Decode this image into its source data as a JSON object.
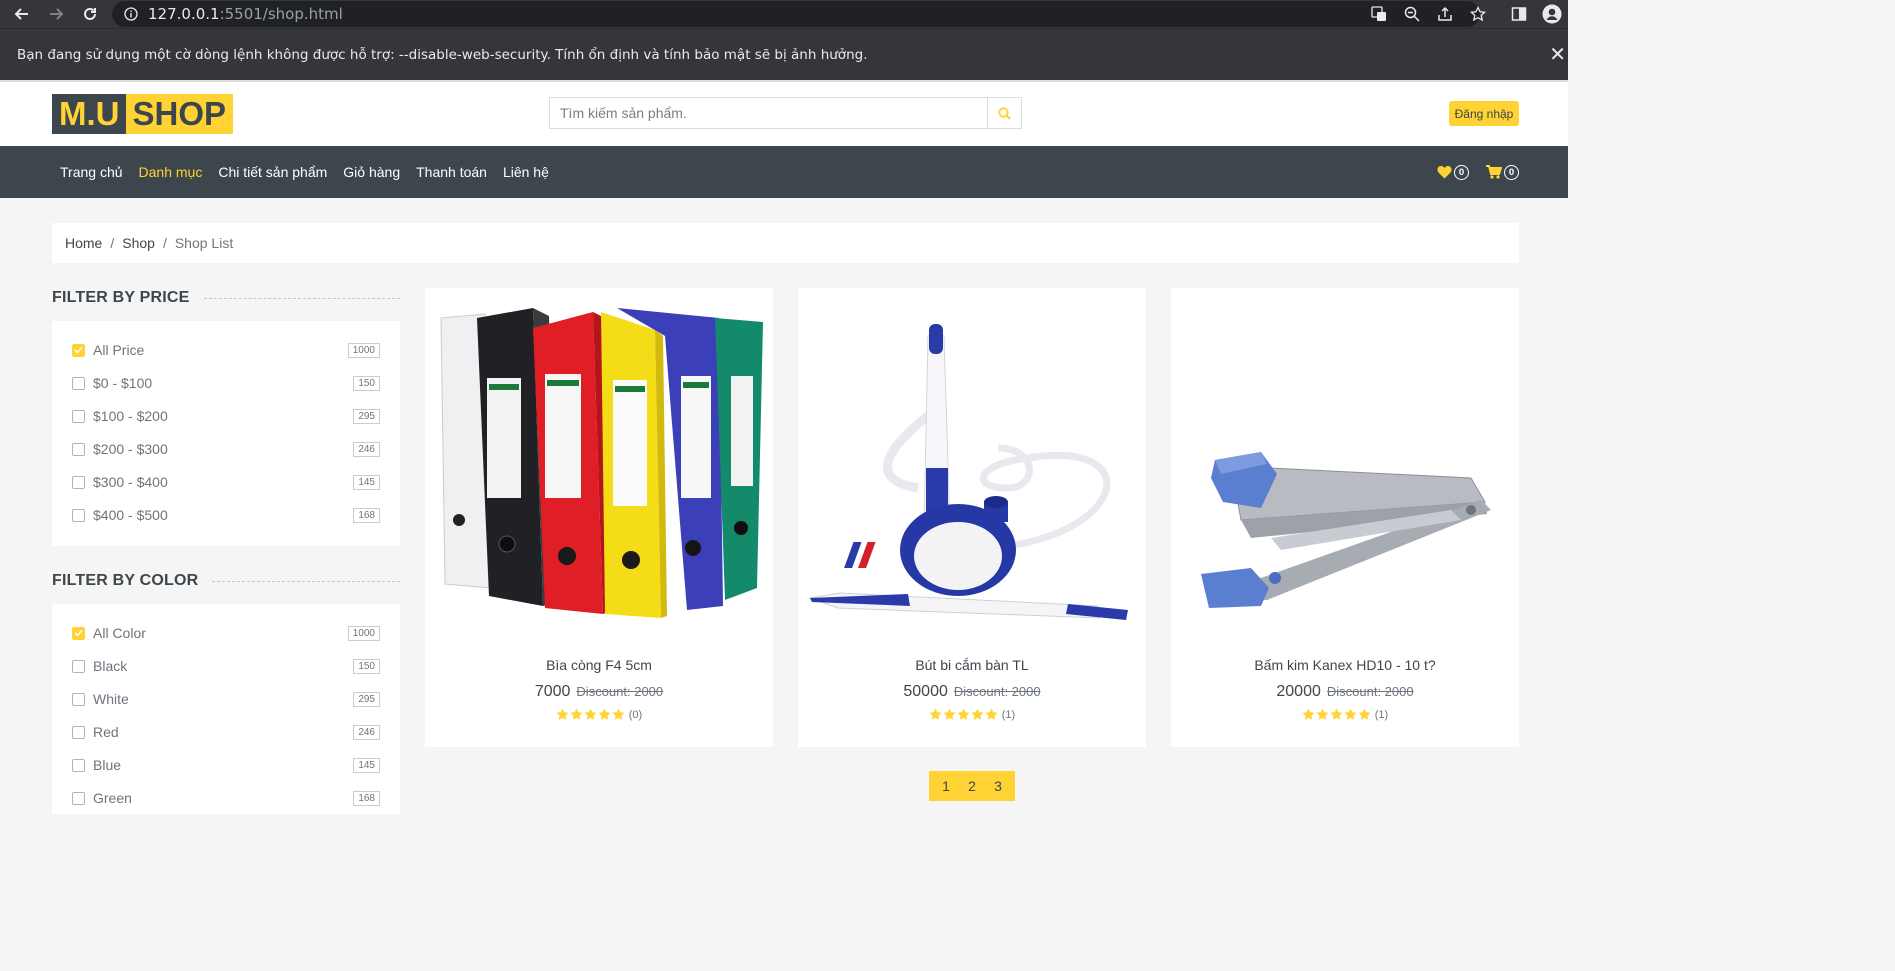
{
  "browser": {
    "url_host": "127.0.0.1",
    "url_path": ":5501/shop.html",
    "warning": "Bạn đang sử dụng một cờ dòng lệnh không được hỗ trợ: --disable-web-security. Tính ổn định và tính bảo mật sẽ bị ảnh hưởng.",
    "close_glyph": "✕"
  },
  "header": {
    "logo_part1": "M.U",
    "logo_part2": "SHOP",
    "search_placeholder": "Tìm kiếm sản phẩm.",
    "login_label": "Đăng nhập"
  },
  "nav": {
    "items": [
      {
        "label": "Trang chủ",
        "active": false
      },
      {
        "label": "Danh mục",
        "active": true
      },
      {
        "label": "Chi tiết sản phẩm",
        "active": false
      },
      {
        "label": "Giỏ hàng",
        "active": false
      },
      {
        "label": "Thanh toán",
        "active": false
      },
      {
        "label": "Liên hệ",
        "active": false
      }
    ],
    "wishlist_count": "0",
    "cart_count": "0"
  },
  "breadcrumb": {
    "home": "Home",
    "shop": "Shop",
    "current": "Shop List",
    "separator": "/"
  },
  "filters": {
    "price": {
      "title": "FILTER BY PRICE",
      "options": [
        {
          "label": "All Price",
          "count": "1000",
          "checked": true
        },
        {
          "label": "$0 - $100",
          "count": "150",
          "checked": false
        },
        {
          "label": "$100 - $200",
          "count": "295",
          "checked": false
        },
        {
          "label": "$200 - $300",
          "count": "246",
          "checked": false
        },
        {
          "label": "$300 - $400",
          "count": "145",
          "checked": false
        },
        {
          "label": "$400 - $500",
          "count": "168",
          "checked": false
        }
      ]
    },
    "color": {
      "title": "FILTER BY COLOR",
      "options": [
        {
          "label": "All Color",
          "count": "1000",
          "checked": true
        },
        {
          "label": "Black",
          "count": "150",
          "checked": false
        },
        {
          "label": "White",
          "count": "295",
          "checked": false
        },
        {
          "label": "Red",
          "count": "246",
          "checked": false
        },
        {
          "label": "Blue",
          "count": "145",
          "checked": false
        },
        {
          "label": "Green",
          "count": "168",
          "checked": false
        }
      ]
    }
  },
  "products": [
    {
      "name": "Bìa còng F4 5cm",
      "price": "7000",
      "old_price": "Discount: 2000",
      "stars": 5,
      "reviews": "(0)",
      "image": "binder-set"
    },
    {
      "name": "Bút bi cắm bàn TL",
      "price": "50000",
      "old_price": "Discount: 2000",
      "stars": 5,
      "reviews": "(1)",
      "image": "desk-pen"
    },
    {
      "name": "Bấm kim Kanex HD10 - 10 t?",
      "price": "20000",
      "old_price": "Discount: 2000",
      "stars": 5,
      "reviews": "(1)",
      "image": "stapler"
    }
  ],
  "pagination": {
    "pages": [
      "1",
      "2",
      "3"
    ]
  },
  "colors": {
    "accent": "#ffd333",
    "dark": "#3d464d",
    "text": "#6c757d",
    "background": "#f5f5f5"
  }
}
